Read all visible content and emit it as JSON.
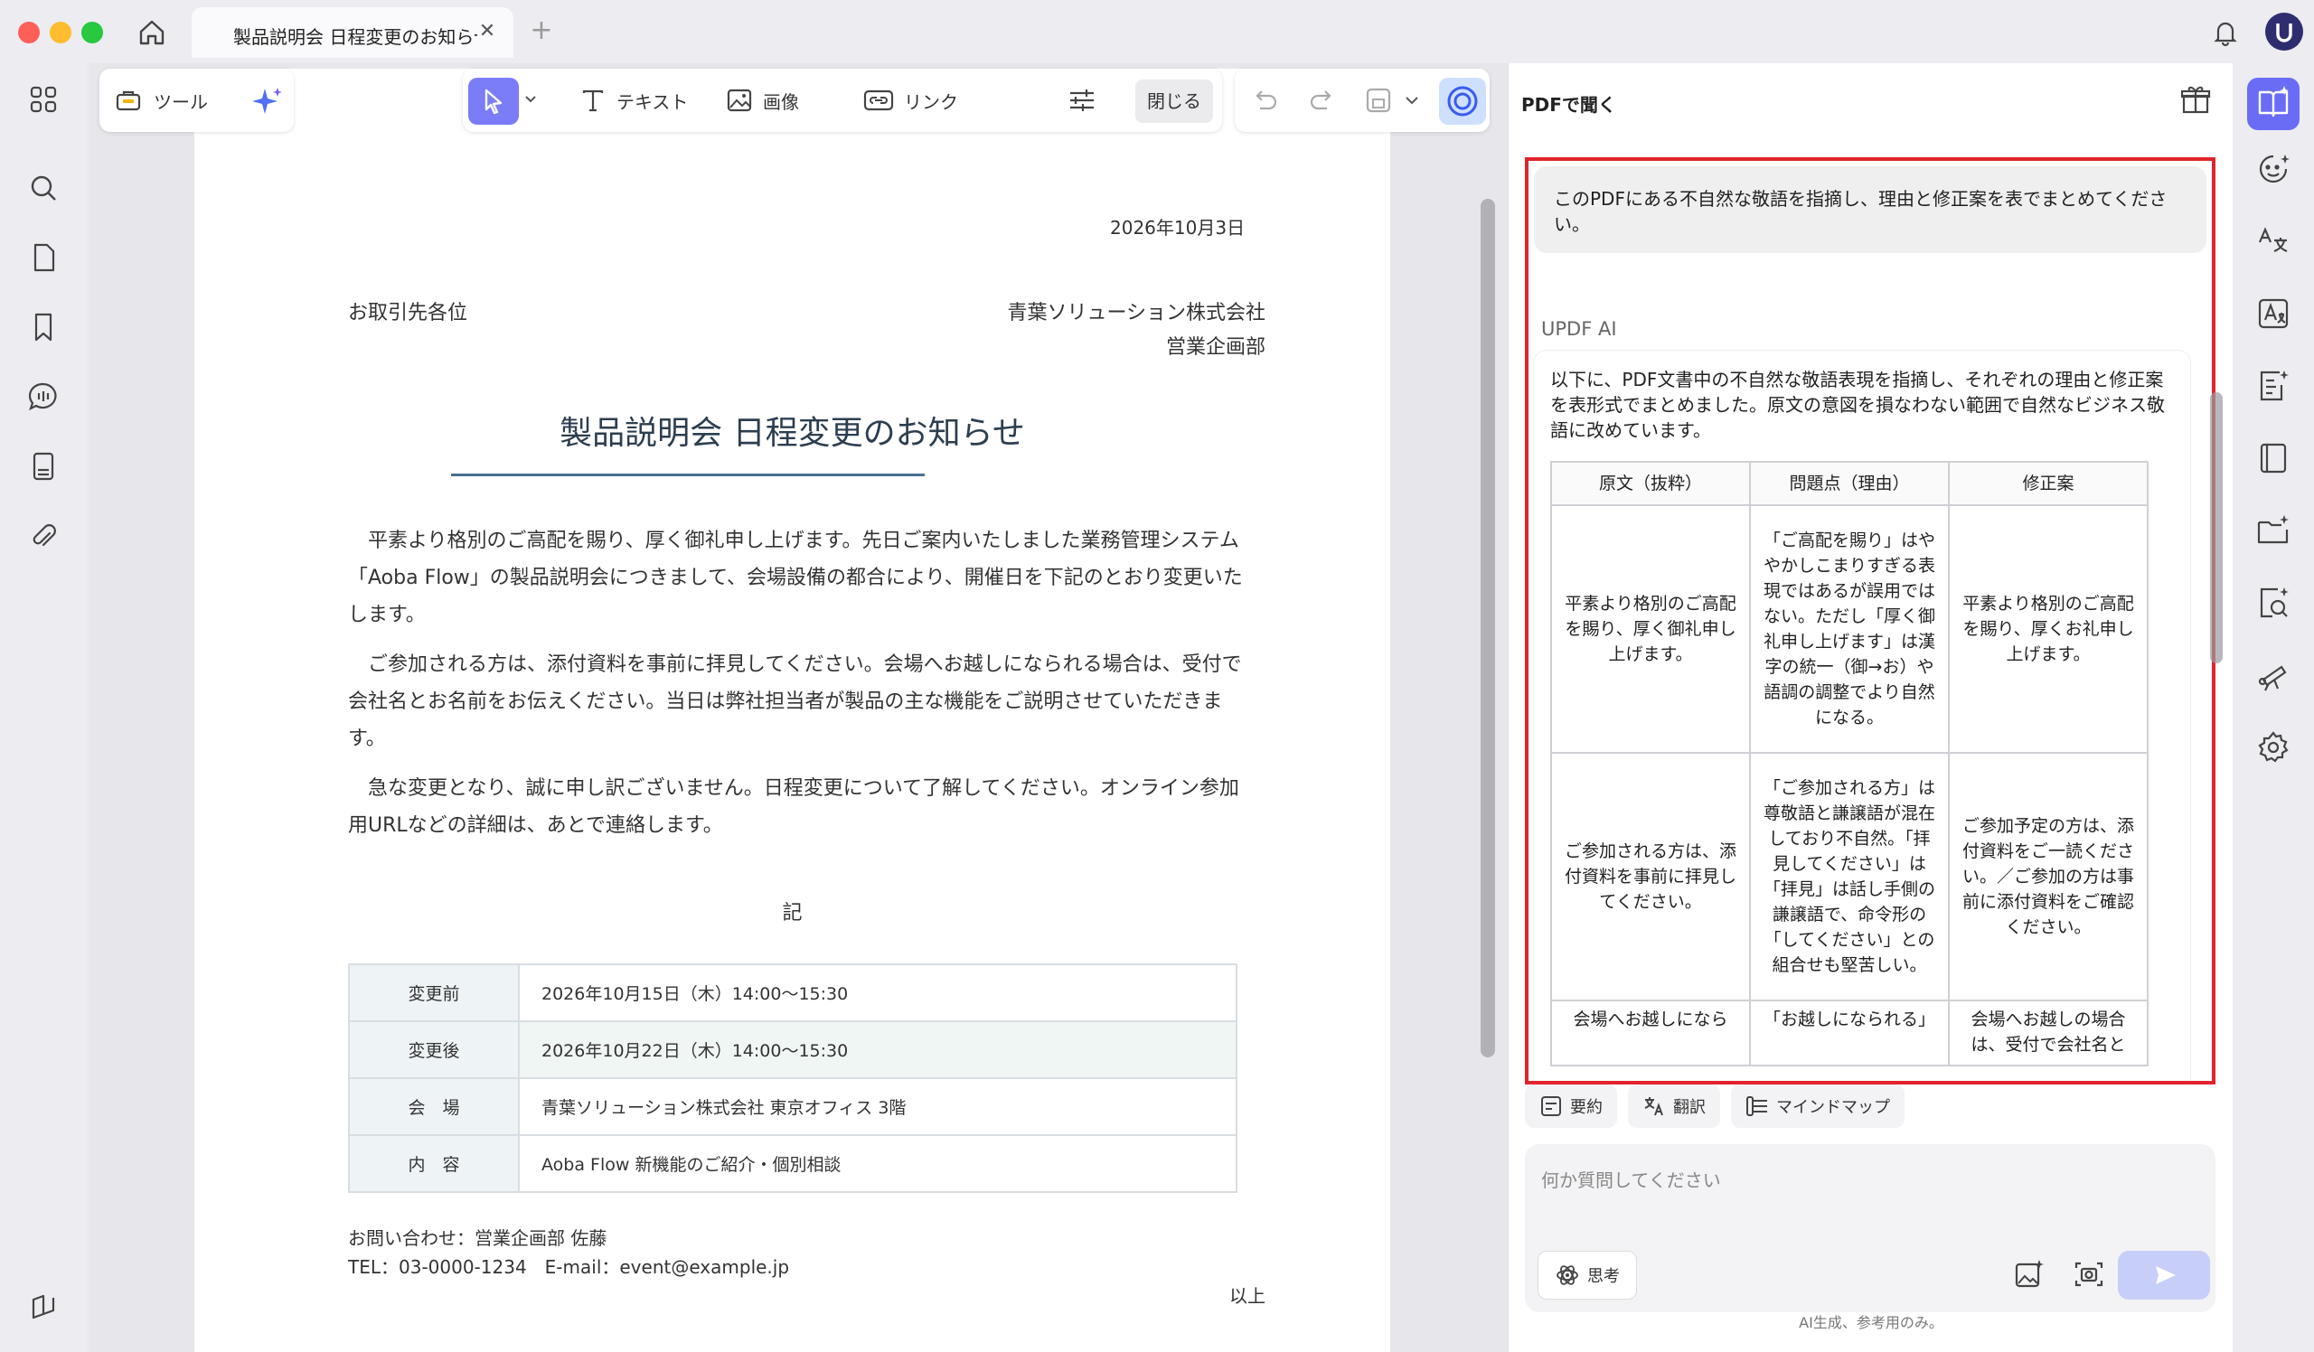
{
  "titlebar": {
    "tab_title": "製品説明会 日程変更のお知らせ",
    "tab_close": "✕",
    "tab_add": "+"
  },
  "toolbar": {
    "tools_label": "ツール",
    "text_label": "テキスト",
    "image_label": "画像",
    "link_label": "リンク",
    "close_label": "閉じる"
  },
  "document": {
    "date": "2026年10月3日",
    "addressee": "お取引先各位",
    "company": "青葉ソリューション株式会社",
    "department": "営業企画部",
    "title": "製品説明会 日程変更のお知らせ",
    "paragraphs": [
      "　平素より格別のご高配を賜り、厚く御礼申し上げます。先日ご案内いたしました業務管理システム「Aoba Flow」の製品説明会につきまして、会場設備の都合により、開催日を下記のとおり変更いたします。",
      "　ご参加される方は、添付資料を事前に拝見してください。会場へお越しになられる場合は、受付で会社名とお名前をお伝えください。当日は弊社担当者が製品の主な機能をご説明させていただきます。",
      "　急な変更となり、誠に申し訳ございません。日程変更について了解してください。オンライン参加用URLなどの詳細は、あとで連絡します。"
    ],
    "ki": "記",
    "schedule": [
      {
        "key": "変更前",
        "value": "2026年10月15日（木）14:00～15:30"
      },
      {
        "key": "変更後",
        "value": "2026年10月22日（木）14:00～15:30"
      },
      {
        "key": "会　場",
        "value": "青葉ソリューション株式会社 東京オフィス 3階"
      },
      {
        "key": "内　容",
        "value": "Aoba Flow 新機能のご紹介・個別相談"
      }
    ],
    "contact_line1": "お問い合わせ：営業企画部 佐藤",
    "contact_line2": "TEL：03-0000-1234　E-mail：event@example.jp",
    "closing": "以上"
  },
  "ai_panel": {
    "title": "PDFで聞く",
    "user_message": "このPDFにある不自然な敬語を指摘し、理由と修正案を表でまとめてください。",
    "ai_name": "UPDF AI",
    "ai_intro": "以下に、PDF文書中の不自然な敬語表現を指摘し、それぞれの理由と修正案を表形式でまとめました。原文の意図を損なわない範囲で自然なビジネス敬語に改めています。",
    "table_headers": [
      "原文（抜粋）",
      "問題点（理由）",
      "修正案"
    ],
    "table_rows": [
      {
        "original": "平素より格別のご高配を賜り、厚く御礼申し上げます。",
        "issue": "「ご高配を賜り」はややかしこまりすぎる表現ではあるが誤用ではない。ただし「厚く御礼申し上げます」は漢字の統一（御→お）や語調の調整でより自然になる。",
        "fix": "平素より格別のご高配を賜り、厚くお礼申し上げます。"
      },
      {
        "original": "ご参加される方は、添付資料を事前に拝見してください。",
        "issue": "「ご参加される方」は尊敬語と謙譲語が混在しており不自然。「拝見してください」は「拝見」は話し手側の謙譲語で、命令形の「してください」との組合せも堅苦しい。",
        "fix": "ご参加予定の方は、添付資料をご一読ください。／ご参加の方は事前に添付資料をご確認ください。"
      },
      {
        "original": "会場へお越しになら",
        "issue": "「お越しになられる」",
        "fix": "会場へお越しの場合は、受付で会社名と"
      }
    ],
    "quick_actions": [
      "要約",
      "翻訳",
      "マインドマップ"
    ],
    "input_placeholder": "何か質問してください",
    "think_label": "思考",
    "disclaimer": "AI生成、参考用のみ。"
  },
  "colors": {
    "accent": "#6a6cf5",
    "highlight_border": "#e1242c",
    "title_rule": "#4a6f8f"
  }
}
